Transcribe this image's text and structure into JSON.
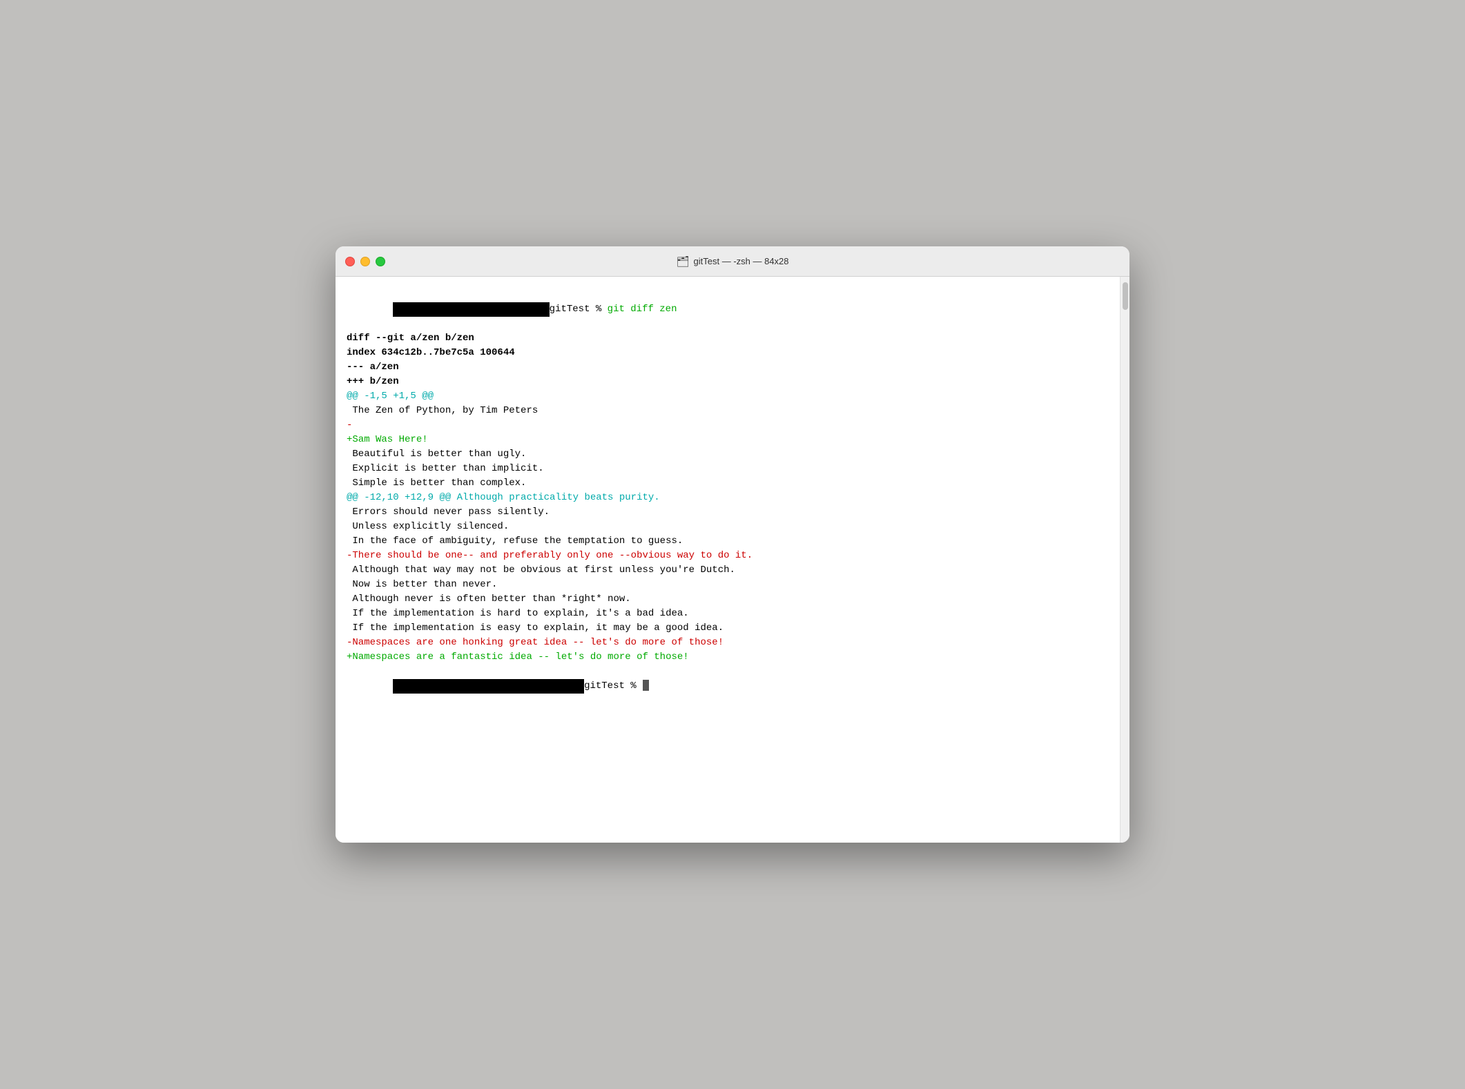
{
  "window": {
    "title": "gitTest — -zsh — 84x28",
    "folder_icon": "🗂"
  },
  "traffic_lights": {
    "close_label": "close",
    "minimize_label": "minimize",
    "maximize_label": "maximize"
  },
  "terminal": {
    "lines": [
      {
        "id": "cmd-line",
        "type": "command",
        "prompt_hidden": true,
        "text": "gitTest % ",
        "command": "git diff zen"
      },
      {
        "id": "diff-header-1",
        "type": "bold-default",
        "text": "diff --git a/zen b/zen"
      },
      {
        "id": "diff-header-2",
        "type": "bold-default",
        "text": "index 634c12b..7be7c5a 100644"
      },
      {
        "id": "diff-header-3",
        "type": "bold-default",
        "text": "--- a/zen"
      },
      {
        "id": "diff-header-4",
        "type": "bold-default",
        "text": "+++ b/zen"
      },
      {
        "id": "hunk-1",
        "type": "cyan",
        "text": "@@ -1,5 +1,5 @@"
      },
      {
        "id": "context-1",
        "type": "default",
        "text": " The Zen of Python, by Tim Peters"
      },
      {
        "id": "removed-1",
        "type": "red",
        "text": "-"
      },
      {
        "id": "added-1",
        "type": "green",
        "text": "+Sam Was Here!"
      },
      {
        "id": "context-2",
        "type": "default",
        "text": " Beautiful is better than ugly."
      },
      {
        "id": "context-3",
        "type": "default",
        "text": " Explicit is better than implicit."
      },
      {
        "id": "context-4",
        "type": "default",
        "text": " Simple is better than complex."
      },
      {
        "id": "hunk-2",
        "type": "cyan",
        "text": "@@ -12,10 +12,9 @@ Although practicality beats purity."
      },
      {
        "id": "context-5",
        "type": "default",
        "text": " Errors should never pass silently."
      },
      {
        "id": "context-6",
        "type": "default",
        "text": " Unless explicitly silenced."
      },
      {
        "id": "context-7",
        "type": "default",
        "text": " In the face of ambiguity, refuse the temptation to guess."
      },
      {
        "id": "removed-2",
        "type": "red",
        "text": "-There should be one-- and preferably only one --obvious way to do it."
      },
      {
        "id": "context-8",
        "type": "default",
        "text": " Although that way may not be obvious at first unless you're Dutch."
      },
      {
        "id": "context-9",
        "type": "default",
        "text": " Now is better than never."
      },
      {
        "id": "context-10",
        "type": "default",
        "text": " Although never is often better than *right* now."
      },
      {
        "id": "context-11",
        "type": "default",
        "text": " If the implementation is hard to explain, it's a bad idea."
      },
      {
        "id": "context-12",
        "type": "default",
        "text": " If the implementation is easy to explain, it may be a good idea."
      },
      {
        "id": "removed-3",
        "type": "red",
        "text": "-Namespaces are one honking great idea -- let's do more of those!"
      },
      {
        "id": "added-2",
        "type": "green",
        "text": "+Namespaces are a fantastic idea -- let's do more of those!"
      },
      {
        "id": "prompt-2",
        "type": "prompt-end",
        "text": "gitTest % "
      }
    ]
  }
}
